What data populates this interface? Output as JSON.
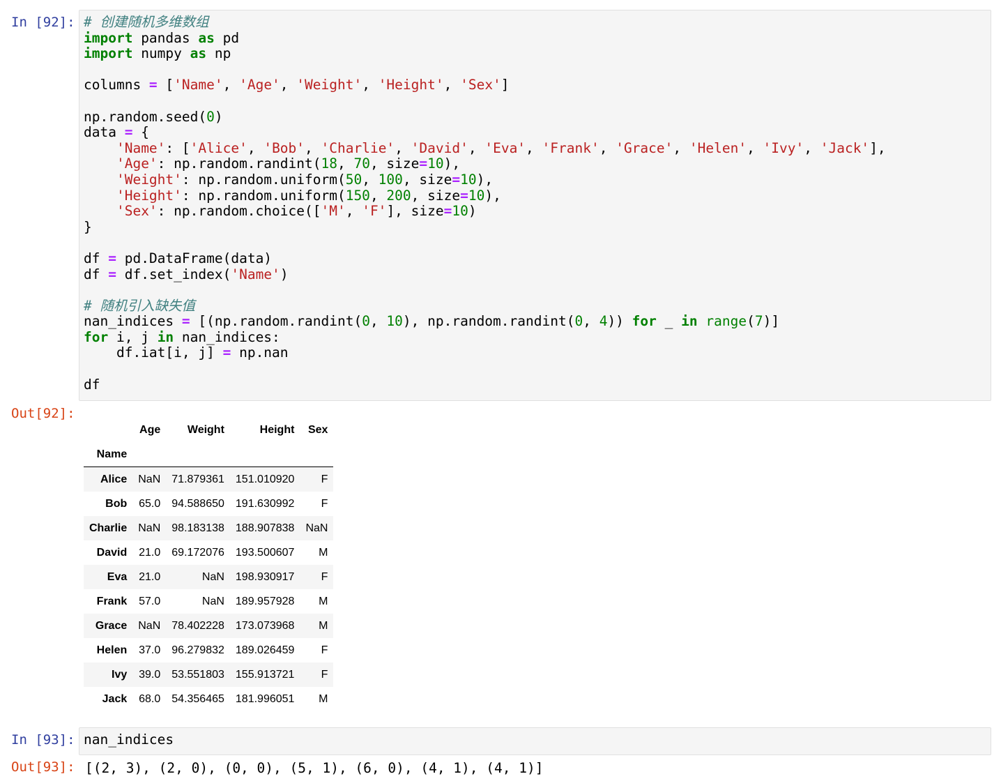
{
  "cells": [
    {
      "in_prompt": "In [92]:",
      "out_prompt": "Out[92]:",
      "code_comment_1": "# 创建随机多维数组",
      "code_comment_2": "# 随机引入缺失值"
    },
    {
      "in_prompt": "In [93]:",
      "out_prompt": "Out[93]:",
      "code": "nan_indices",
      "output": "[(2, 3), (2, 0), (0, 0), (5, 1), (6, 0), (4, 1), (4, 1)]"
    }
  ],
  "dataframe": {
    "index_name": "Name",
    "columns": [
      "Age",
      "Weight",
      "Height",
      "Sex"
    ],
    "rows": [
      {
        "name": "Alice",
        "values": [
          "NaN",
          "71.879361",
          "151.010920",
          "F"
        ]
      },
      {
        "name": "Bob",
        "values": [
          "65.0",
          "94.588650",
          "191.630992",
          "F"
        ]
      },
      {
        "name": "Charlie",
        "values": [
          "NaN",
          "98.183138",
          "188.907838",
          "NaN"
        ]
      },
      {
        "name": "David",
        "values": [
          "21.0",
          "69.172076",
          "193.500607",
          "M"
        ]
      },
      {
        "name": "Eva",
        "values": [
          "21.0",
          "NaN",
          "198.930917",
          "F"
        ]
      },
      {
        "name": "Frank",
        "values": [
          "57.0",
          "NaN",
          "189.957928",
          "M"
        ]
      },
      {
        "name": "Grace",
        "values": [
          "NaN",
          "78.402228",
          "173.073968",
          "M"
        ]
      },
      {
        "name": "Helen",
        "values": [
          "37.0",
          "96.279832",
          "189.026459",
          "F"
        ]
      },
      {
        "name": "Ivy",
        "values": [
          "39.0",
          "53.551803",
          "155.913721",
          "F"
        ]
      },
      {
        "name": "Jack",
        "values": [
          "68.0",
          "54.356465",
          "181.996051",
          "M"
        ]
      }
    ]
  },
  "colors": {
    "in_prompt": "#303f9f",
    "out_prompt": "#d84315",
    "keyword": "#008000",
    "string": "#ba2121",
    "operator": "#aa22ff",
    "comment": "#408080",
    "cell_background": "#f5f5f5"
  }
}
